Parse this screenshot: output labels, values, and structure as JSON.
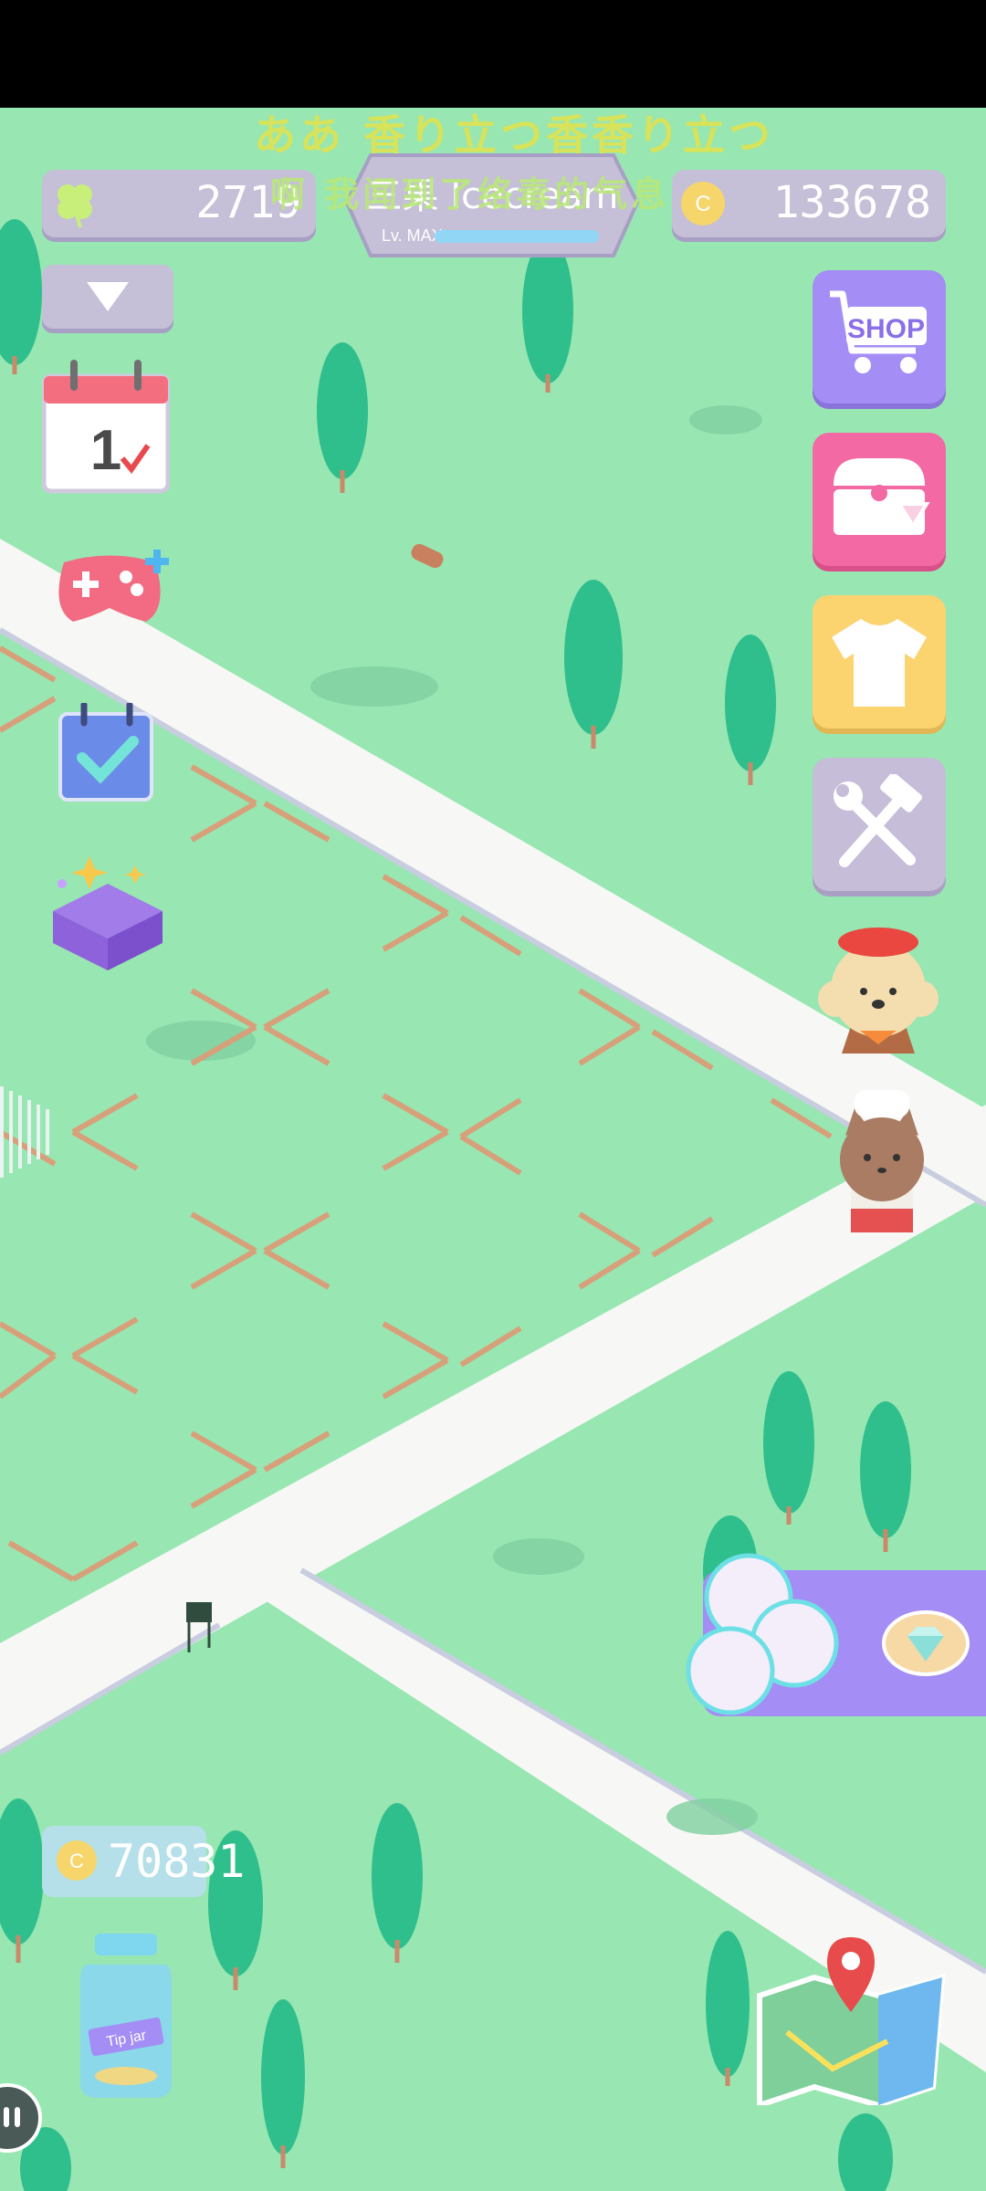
{
  "overlay": {
    "line1": "ああ 香り立つ香香り立つ",
    "line2": "啊 我闻到了络毒的气息"
  },
  "hud": {
    "clover_value": "2719",
    "shop_title": "三果 Icecream",
    "level_label": "Lv. MAX",
    "coin_value": "133678"
  },
  "side_buttons": {
    "shop_label": "SHOP"
  },
  "tip_jar": {
    "coin_value": "70831",
    "jar_text": "Tip jar"
  },
  "colors": {
    "grass": "#98e6b2",
    "road": "#f7f8f5",
    "shop": "#a48df4",
    "chest": "#f269a4",
    "shirt": "#fbd36f",
    "tools": "#c6bdd9",
    "pill": "#c5bfd7"
  }
}
